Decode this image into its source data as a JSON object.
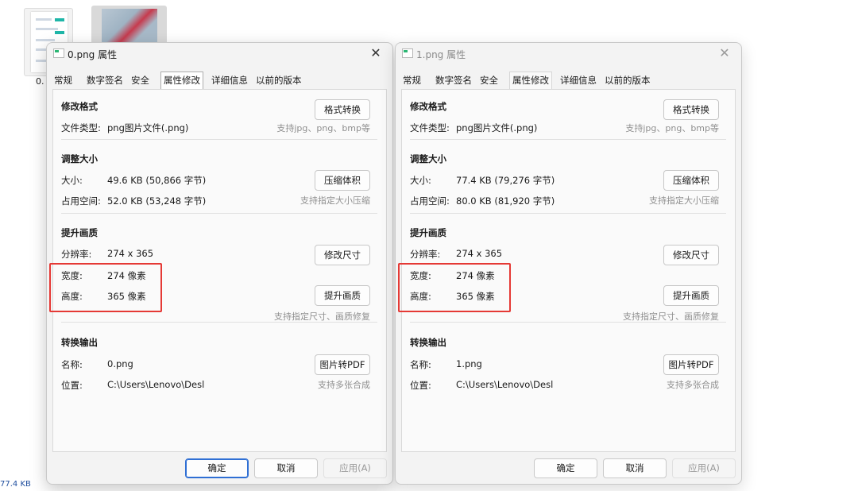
{
  "background": {
    "file0_label": "0.",
    "status_size": "77.4 KB"
  },
  "dialogs": [
    {
      "title": "0.png 属性",
      "close": "✕",
      "tabs": [
        "常规",
        "数字签名",
        "安全",
        "属性修改",
        "详细信息",
        "以前的版本"
      ],
      "active_tab": "属性修改",
      "format": {
        "section": "修改格式",
        "button": "格式转换",
        "type_label": "文件类型:",
        "type_value": "png图片文件(.png)",
        "hint": "支持jpg、png、bmp等"
      },
      "resize": {
        "section": "调整大小",
        "size_label": "大小:",
        "size_value": "49.6 KB (50,866 字节)",
        "disk_label": "占用空间:",
        "disk_value": "52.0 KB (53,248 字节)",
        "button": "压缩体积",
        "hint": "支持指定大小压缩"
      },
      "quality": {
        "section": "提升画质",
        "res_label": "分辨率:",
        "res_value": "274 x 365",
        "resize_button": "修改尺寸",
        "width_label": "宽度:",
        "width_value": "274 像素",
        "height_label": "高度:",
        "height_value": "365 像素",
        "enhance_button": "提升画质",
        "hint": "支持指定尺寸、画质修复"
      },
      "convert": {
        "section": "转换输出",
        "name_label": "名称:",
        "name_value": "0.png",
        "pdf_button": "图片转PDF",
        "location_label": "位置:",
        "location_value": "C:\\Users\\Lenovo\\Desl",
        "hint": "支持多张合成"
      },
      "footer": {
        "ok": "确定",
        "cancel": "取消",
        "apply": "应用(A)"
      }
    },
    {
      "title": "1.png 属性",
      "close": "✕",
      "tabs": [
        "常规",
        "数字签名",
        "安全",
        "属性修改",
        "详细信息",
        "以前的版本"
      ],
      "active_tab": "属性修改",
      "format": {
        "section": "修改格式",
        "button": "格式转换",
        "type_label": "文件类型:",
        "type_value": "png图片文件(.png)",
        "hint": "支持jpg、png、bmp等"
      },
      "resize": {
        "section": "调整大小",
        "size_label": "大小:",
        "size_value": "77.4 KB (79,276 字节)",
        "disk_label": "占用空间:",
        "disk_value": "80.0 KB (81,920 字节)",
        "button": "压缩体积",
        "hint": "支持指定大小压缩"
      },
      "quality": {
        "section": "提升画质",
        "res_label": "分辨率:",
        "res_value": "274 x 365",
        "resize_button": "修改尺寸",
        "width_label": "宽度:",
        "width_value": "274 像素",
        "height_label": "高度:",
        "height_value": "365 像素",
        "enhance_button": "提升画质",
        "hint": "支持指定尺寸、画质修复"
      },
      "convert": {
        "section": "转换输出",
        "name_label": "名称:",
        "name_value": "1.png",
        "pdf_button": "图片转PDF",
        "location_label": "位置:",
        "location_value": "C:\\Users\\Lenovo\\Desl",
        "hint": "支持多张合成"
      },
      "footer": {
        "ok": "确定",
        "cancel": "取消",
        "apply": "应用(A)"
      }
    }
  ],
  "colors": {
    "highlight": "#e53935",
    "focus": "#2f6fd4"
  }
}
